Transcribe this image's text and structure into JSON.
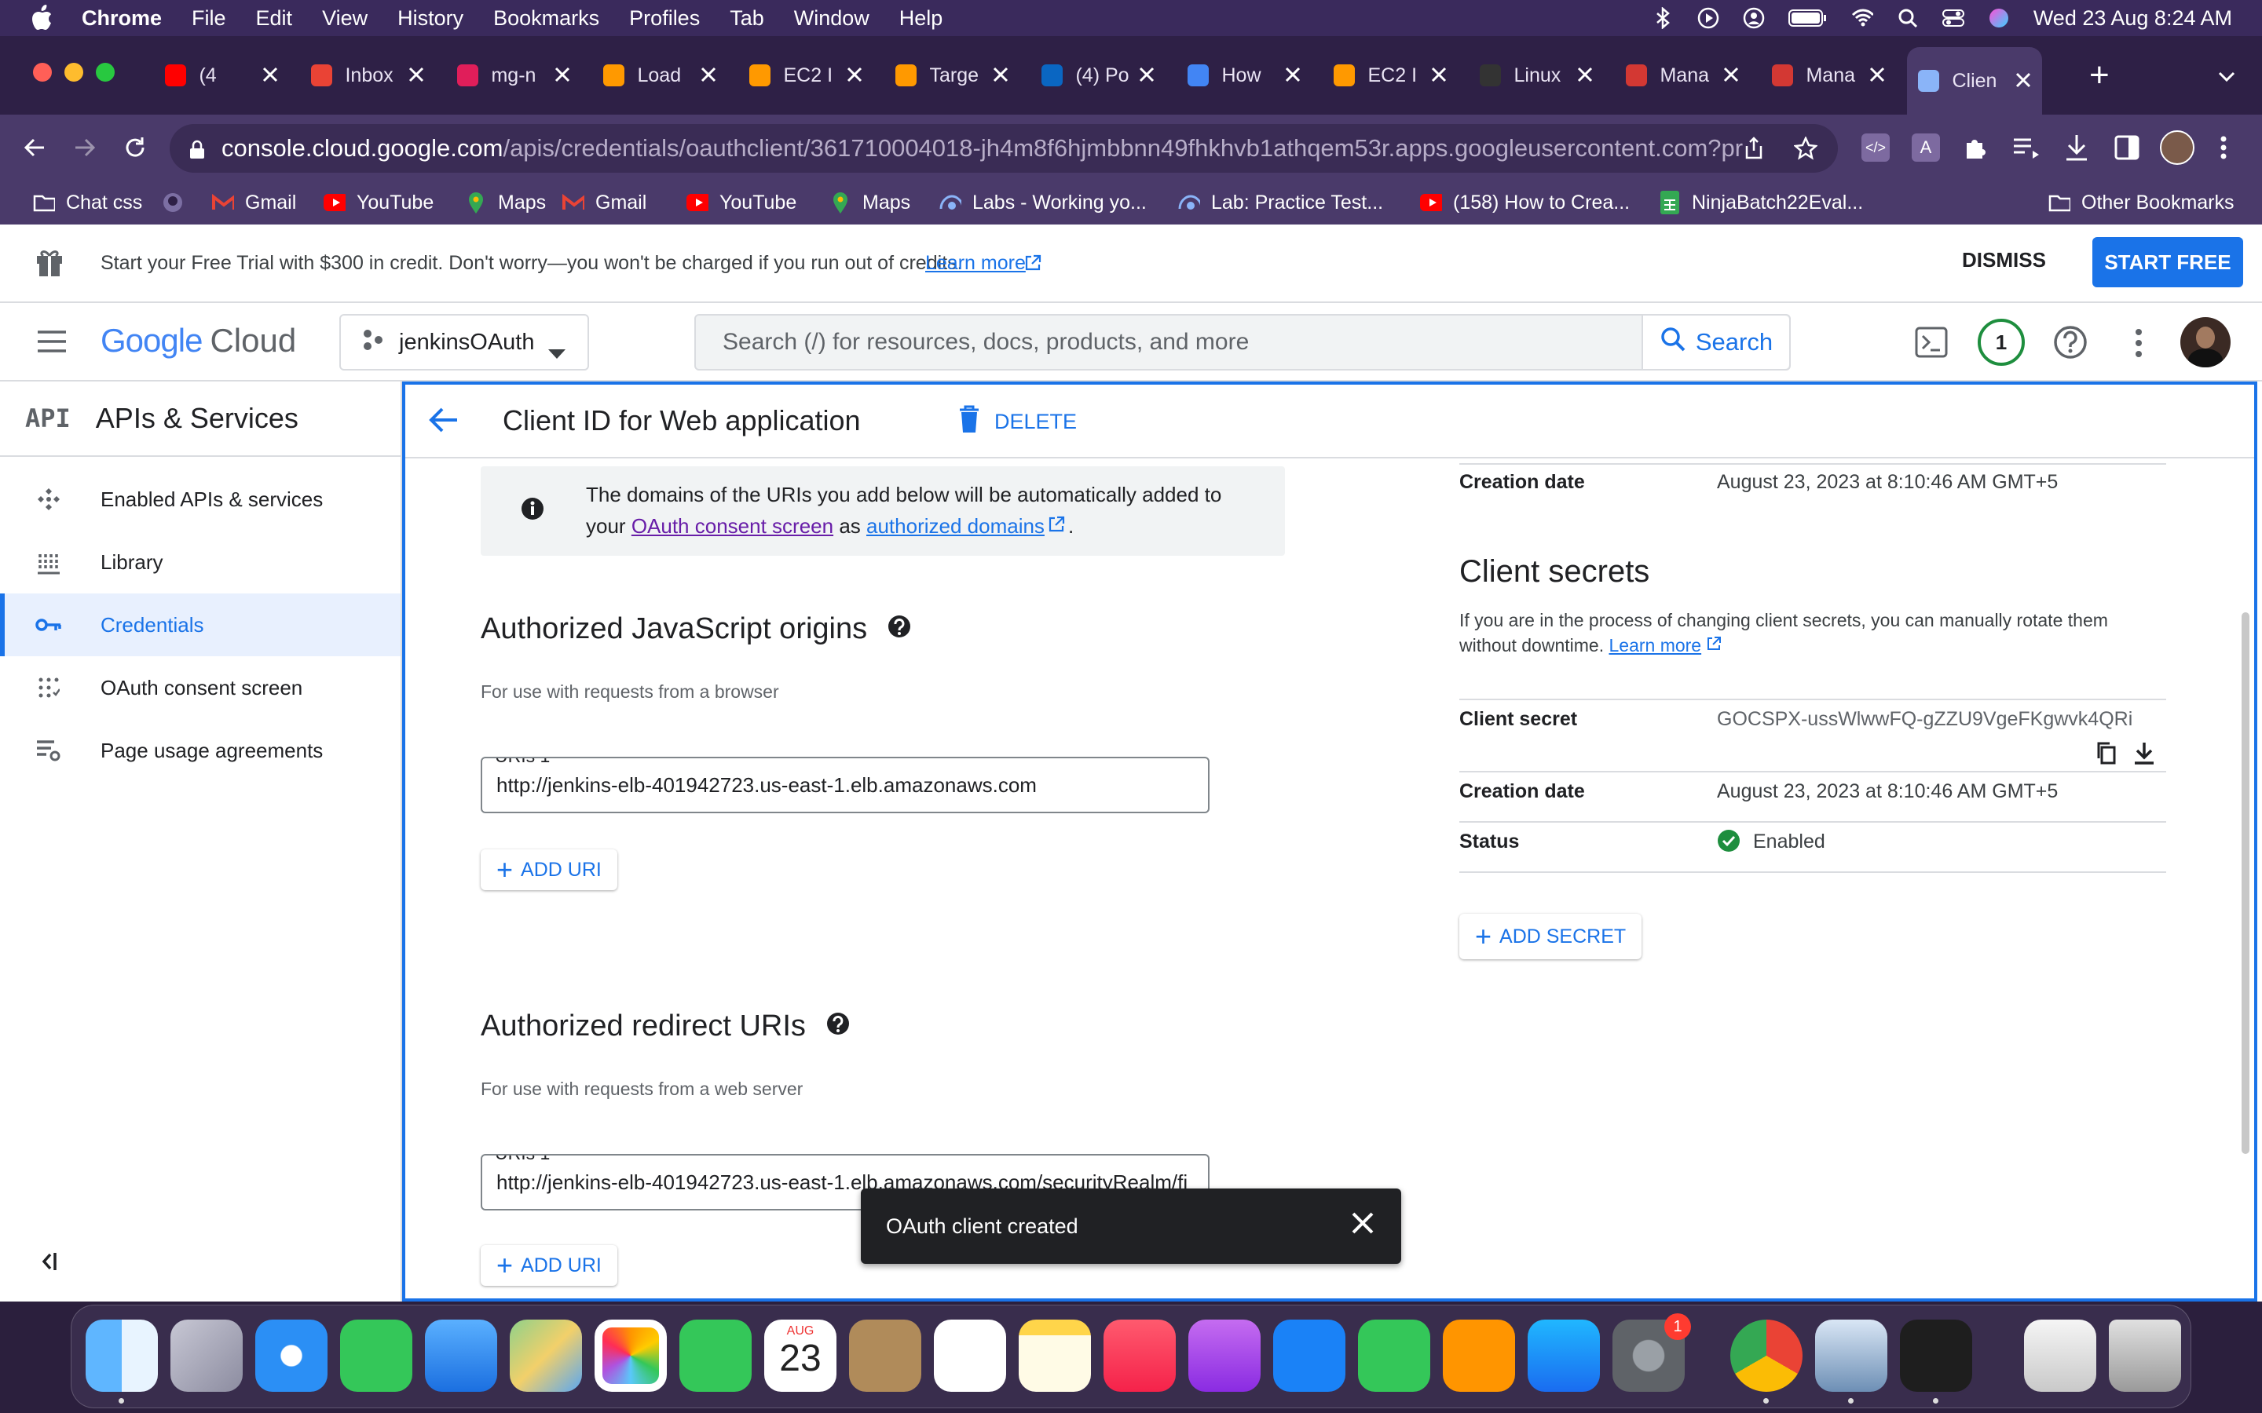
{
  "menubar": {
    "app": "Chrome",
    "items": [
      "File",
      "Edit",
      "View",
      "History",
      "Bookmarks",
      "Profiles",
      "Tab",
      "Window",
      "Help"
    ],
    "datetime": "Wed 23 Aug  8:24 AM"
  },
  "tabs": [
    {
      "label": "(4",
      "icon": "youtube-icon",
      "color": "#ff0000"
    },
    {
      "label": "Inbox",
      "icon": "gmail-icon",
      "color": "#ea4335"
    },
    {
      "label": "mg-n",
      "icon": "slack-icon",
      "color": "#e01e5a"
    },
    {
      "label": "Load",
      "icon": "aws-icon",
      "color": "#ff9900"
    },
    {
      "label": "EC2 I",
      "icon": "aws-icon",
      "color": "#ff9900"
    },
    {
      "label": "Targe",
      "icon": "aws-icon",
      "color": "#ff9900"
    },
    {
      "label": "(4) Po",
      "icon": "linkedin-icon",
      "color": "#0a66c2"
    },
    {
      "label": "How",
      "icon": "infinity-icon",
      "color": "#4285f4"
    },
    {
      "label": "EC2 I",
      "icon": "aws-icon",
      "color": "#ff9900"
    },
    {
      "label": "Linux",
      "icon": "penguin-icon",
      "color": "#333333"
    },
    {
      "label": "Mana",
      "icon": "jenkins-icon",
      "color": "#d33833"
    },
    {
      "label": "Mana",
      "icon": "jenkins-icon",
      "color": "#d33833"
    },
    {
      "label": "Clien",
      "icon": "api-icon",
      "color": "#8ab4f8"
    }
  ],
  "address": {
    "host": "console.cloud.google.com",
    "path": "/apis/credentials/oauthclient/361710004018-jh4m8f6hjmbbnn49fhkhvb1athqem53r.apps.googleusercontent.com?pr..."
  },
  "bookmarks": [
    {
      "label": "Chat css",
      "icon": "folder-icon"
    },
    {
      "label": "",
      "icon": "github-icon"
    },
    {
      "label": "Gmail",
      "icon": "gmail-icon"
    },
    {
      "label": "YouTube",
      "icon": "youtube-icon"
    },
    {
      "label": "Maps",
      "icon": "maps-icon"
    },
    {
      "label": "Gmail",
      "icon": "gmail-icon"
    },
    {
      "label": "YouTube",
      "icon": "youtube-icon"
    },
    {
      "label": "Maps",
      "icon": "maps-icon"
    },
    {
      "label": "Labs - Working yo...",
      "icon": "labs-icon"
    },
    {
      "label": "Lab: Practice Test...",
      "icon": "labs-icon"
    },
    {
      "label": "(158) How to Crea...",
      "icon": "youtube-icon"
    },
    {
      "label": "NinjaBatch22Eval...",
      "icon": "sheets-icon"
    }
  ],
  "other_bookmarks": "Other Bookmarks",
  "banner": {
    "text": "Start your Free Trial with $300 in credit. Don't worry—you won't be charged if you run out of credits.",
    "learn": "Learn more",
    "dismiss": "DISMISS",
    "start": "START FREE"
  },
  "appbar": {
    "logo_google": "Google",
    "logo_cloud": "Cloud",
    "project": "jenkinsOAuth",
    "search_placeholder": "Search (/) for resources, docs, products, and more",
    "search_btn": "Search",
    "notif_count": "1"
  },
  "sidebar": {
    "title": "APIs & Services",
    "badge": "API",
    "items": [
      {
        "label": "Enabled APIs & services",
        "icon": "enabled-apis-icon"
      },
      {
        "label": "Library",
        "icon": "library-icon"
      },
      {
        "label": "Credentials",
        "icon": "key-icon"
      },
      {
        "label": "OAuth consent screen",
        "icon": "consent-icon"
      },
      {
        "label": "Page usage agreements",
        "icon": "agreements-icon"
      }
    ]
  },
  "main": {
    "title": "Client ID for Web application",
    "delete": "DELETE",
    "info_1": "The domains of the URIs you add below will be automatically added to",
    "info_your": "your",
    "info_consent": "OAuth consent screen",
    "info_as": "as",
    "info_domains": "authorized domains",
    "info_end": ".",
    "js_title": "Authorized JavaScript origins",
    "js_sub": "For use with requests from a browser",
    "js_label": "URIs 1 *",
    "js_value": "http://jenkins-elb-401942723.us-east-1.elb.amazonaws.com",
    "add_uri": "ADD URI",
    "redir_title": "Authorized redirect URIs",
    "redir_sub": "For use with requests from a web server",
    "redir_label": "URIs 1 *",
    "redir_value": "http://jenkins-elb-401942723.us-east-1.elb.amazonaws.com/securityRealm/fi"
  },
  "right": {
    "creation_label": "Creation date",
    "creation_value": "August 23, 2023 at 8:10:46 AM GMT+5",
    "secrets_title": "Client secrets",
    "secrets_desc_1": "If you are in the process of changing client secrets, you can manually rotate them",
    "secrets_desc_2": "without downtime.",
    "learn": "Learn more",
    "secret_label": "Client secret",
    "secret_value": "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",
    "creation2_label": "Creation date",
    "creation2_value": "August 23, 2023 at 8:10:46 AM GMT+5",
    "status_label": "Status",
    "status_value": "Enabled",
    "add_secret": "ADD SECRET"
  },
  "toast": {
    "text": "OAuth client created"
  },
  "dock": {
    "calendar_month": "AUG",
    "calendar_day": "23",
    "settings_badge": "1"
  },
  "colors": {
    "accent": "#1a73e8",
    "active_bg": "#e8f0fe",
    "success": "#1e8e3e"
  }
}
